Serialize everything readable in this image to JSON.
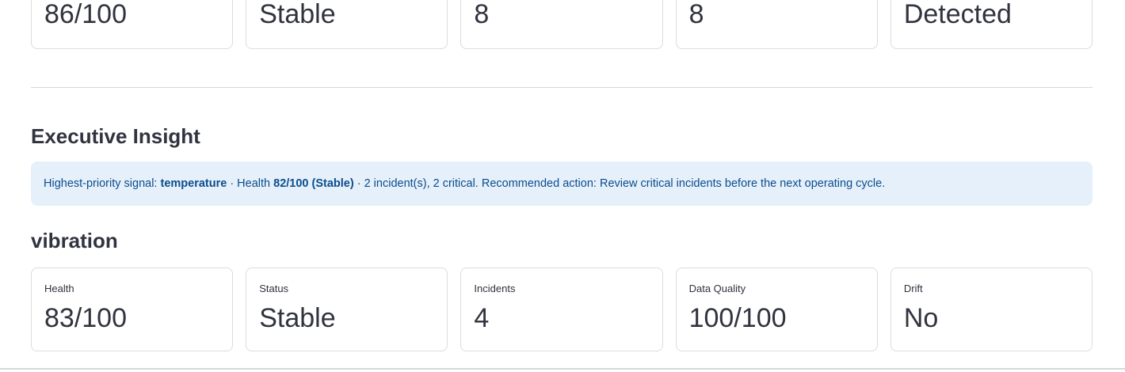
{
  "top_metrics": [
    {
      "value": "86/100"
    },
    {
      "value": "Stable"
    },
    {
      "value": "8"
    },
    {
      "value": "8"
    },
    {
      "value": "Detected"
    }
  ],
  "executive_insight": {
    "heading": "Executive Insight",
    "prefix": "Highest-priority signal: ",
    "signal": "temperature",
    "sep1": " · Health ",
    "health": "82/100 (Stable)",
    "suffix": " · 2 incident(s), 2 critical. Recommended action: Review critical incidents before the next operating cycle."
  },
  "vibration": {
    "heading": "vibration",
    "metrics": [
      {
        "label": "Health",
        "value": "83/100"
      },
      {
        "label": "Status",
        "value": "Stable"
      },
      {
        "label": "Incidents",
        "value": "4"
      },
      {
        "label": "Data Quality",
        "value": "100/100"
      },
      {
        "label": "Drift",
        "value": "No"
      }
    ]
  },
  "colors": {
    "info_background": "#e6f0fb",
    "info_text": "#0a4d8c",
    "card_border": "#dadce3",
    "text": "#31333f"
  }
}
